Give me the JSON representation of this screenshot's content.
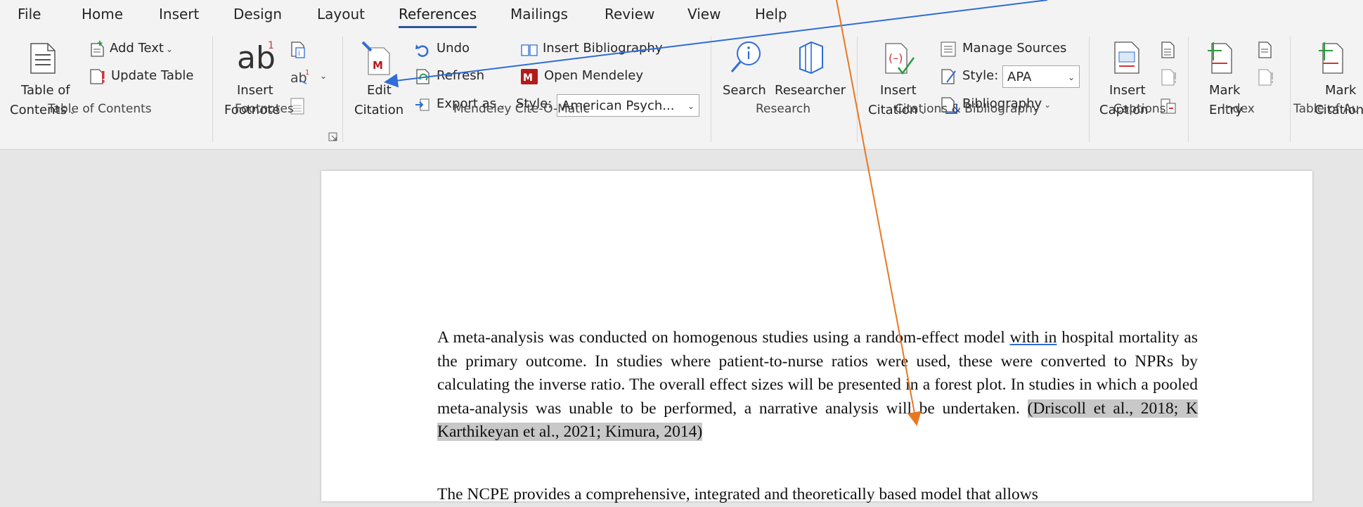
{
  "tabs": [
    "File",
    "Home",
    "Insert",
    "Design",
    "Layout",
    "References",
    "Mailings",
    "Review",
    "View",
    "Help"
  ],
  "active_tab": "References",
  "ribbon": {
    "toc": {
      "add_text": "Add Text",
      "update_table": "Update Table",
      "table_of": "Table of",
      "contents": "Contents",
      "group": "Table of Contents"
    },
    "footnotes": {
      "ab": "ab",
      "sup": "1",
      "insert": "Insert",
      "footnote": "Footnote",
      "group": "Footnotes"
    },
    "mendeley": {
      "edit": "Edit",
      "citation": "Citation",
      "undo": "Undo",
      "refresh": "Refresh",
      "export_as": "Export as",
      "insert_bibliography": "Insert Bibliography",
      "open_mendeley": "Open Mendeley",
      "style_label": "Style:",
      "style_value": "American Psych...",
      "group": "Mendeley Cite-O-Matic"
    },
    "research": {
      "search": "Search",
      "researcher": "Researcher",
      "group": "Research"
    },
    "citations": {
      "insert": "Insert",
      "citation": "Citation",
      "manage_sources": "Manage Sources",
      "style_label": "Style:",
      "style_value": "APA",
      "bibliography": "Bibliography",
      "group": "Citations & Bibliography"
    },
    "captions": {
      "insert": "Insert",
      "caption": "Caption",
      "group": "Captions"
    },
    "index": {
      "mark": "Mark",
      "entry": "Entry",
      "group": "Index"
    },
    "toa": {
      "mark": "Mark",
      "citation": "Citation",
      "group": "Table of Au"
    }
  },
  "document": {
    "p1_a": "A meta-analysis was conducted on homogenous studies using a random-effect model ",
    "p1_link": "with in",
    "p1_b": " hospital mortality as the primary outcome.  In studies where patient-to-nurse ratios were used, these were converted to NPRs by calculating the inverse ratio. The overall effect sizes will be presented in a forest plot. In studies in which a pooled meta-analysis was unable to be performed, a narrative analysis will be undertaken. ",
    "p1_citation": "(Driscoll et al., 2018; K Karthikeyan et al., 2021; Kimura, 2014)",
    "p2": "The NCPE provides a comprehensive, integrated and theoretically based model that allows"
  },
  "colors": {
    "accent": "#2b579a",
    "arrow_blue": "#2f6cd6",
    "arrow_orange": "#e87722",
    "mendeley_red": "#b31b1b"
  }
}
